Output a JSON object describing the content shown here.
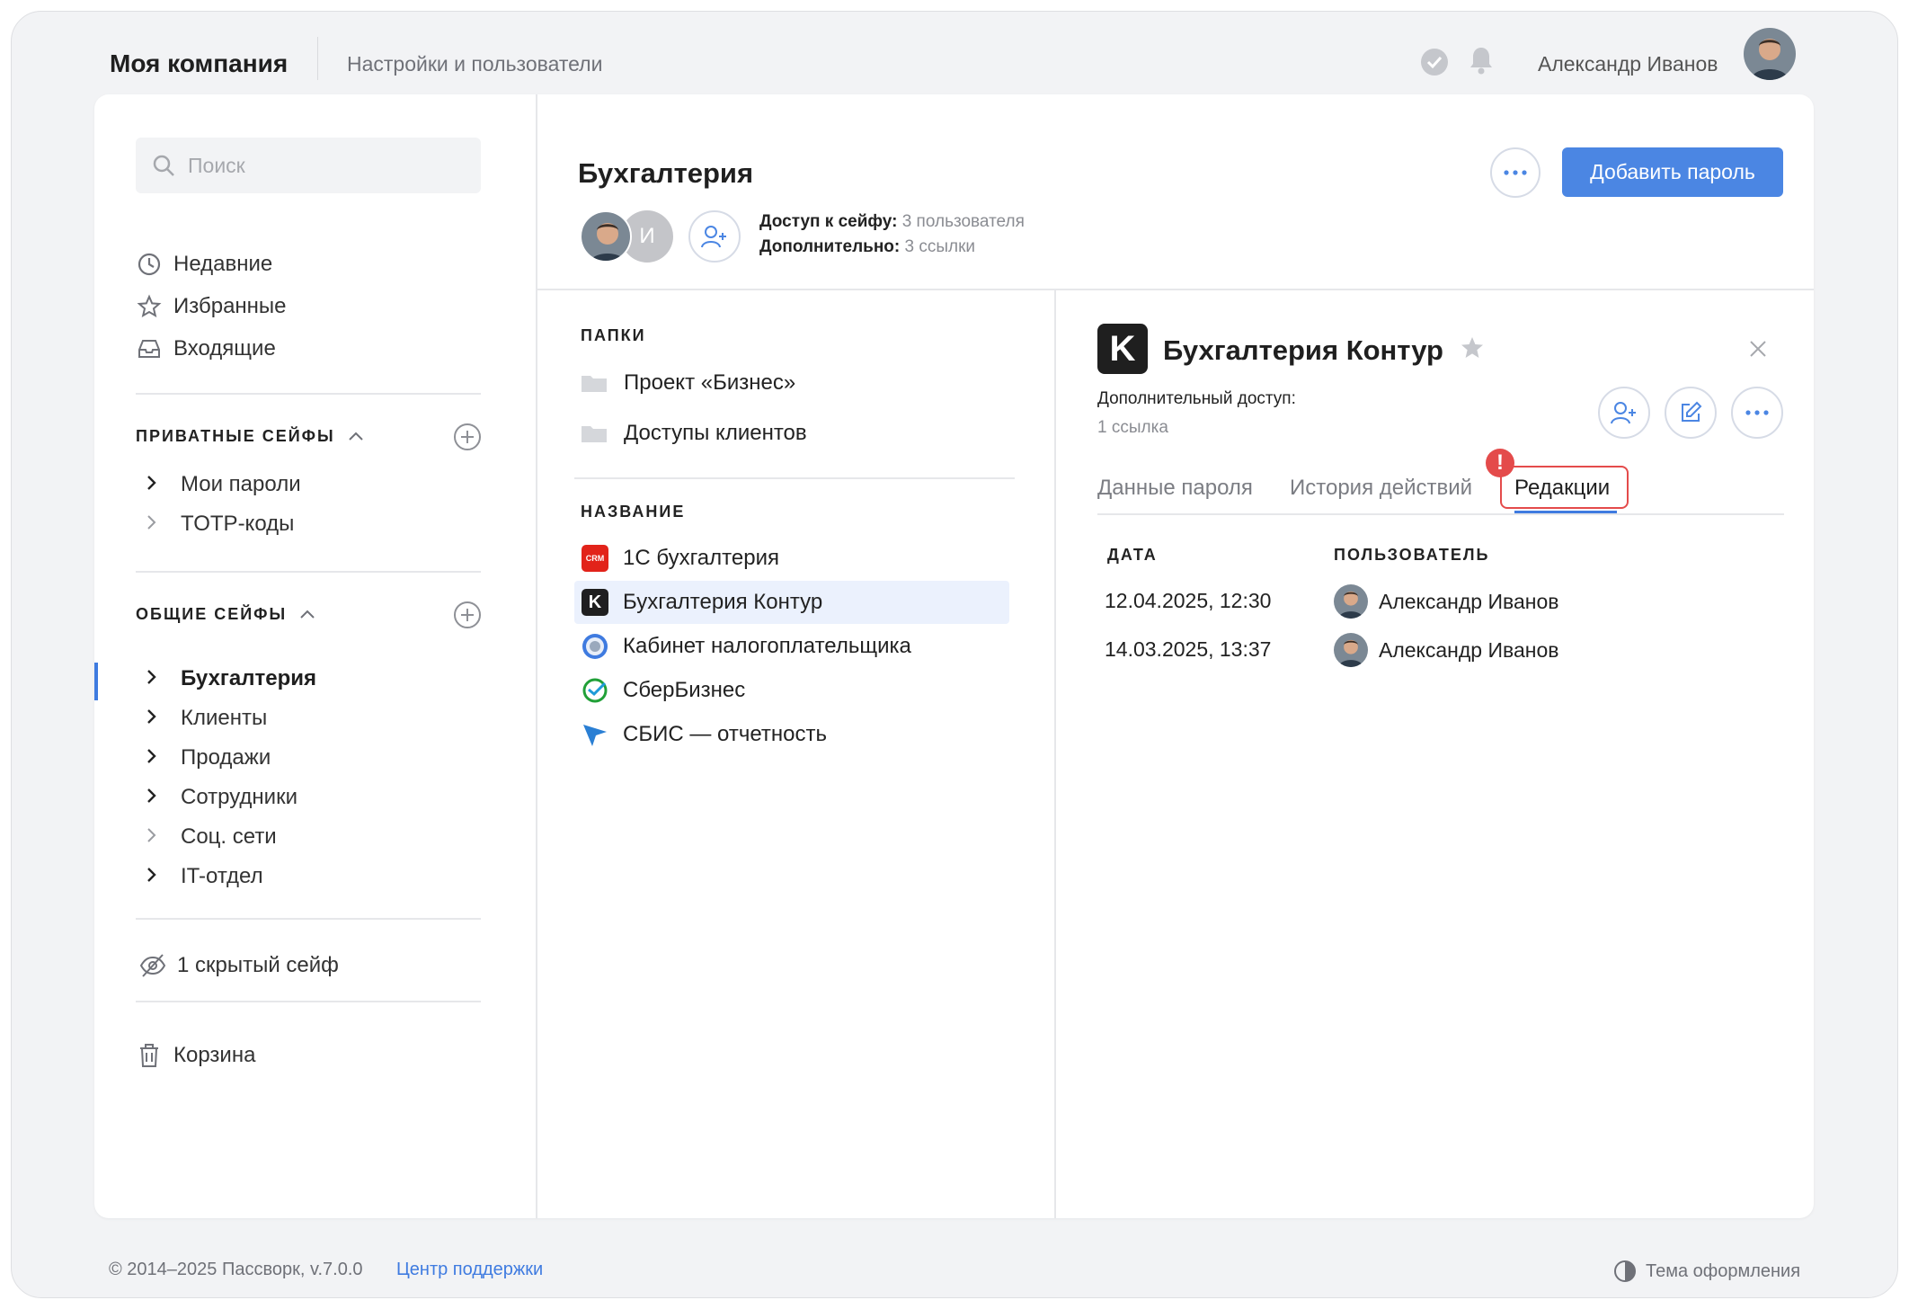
{
  "header": {
    "company": "Моя компания",
    "breadcrumb": "Настройки и пользователи",
    "user_name": "Александр Иванов"
  },
  "sidebar": {
    "search_placeholder": "Поиск",
    "nav": [
      {
        "label": "Недавние",
        "icon": "clock-icon"
      },
      {
        "label": "Избранные",
        "icon": "star-icon"
      },
      {
        "label": "Входящие",
        "icon": "inbox-icon"
      }
    ],
    "private_title": "ПРИВАТНЫЕ СЕЙФЫ",
    "private_vaults": [
      "Мои пароли",
      "TOTP-коды"
    ],
    "shared_title": "ОБЩИЕ СЕЙФЫ",
    "shared_vaults": [
      "Бухгалтерия",
      "Клиенты",
      "Продажи",
      "Сотрудники",
      "Соц. сети",
      "IT-отдел"
    ],
    "hidden": "1 скрытый сейф",
    "trash": "Корзина"
  },
  "vault": {
    "title": "Бухгалтерия",
    "avatar_initial": "И",
    "access_label": "Доступ к сейфу:",
    "access_value": "3 пользователя",
    "extra_label": "Дополнительно:",
    "extra_value": "3 ссылки",
    "add_button": "Добавить пароль"
  },
  "list": {
    "folders_title": "ПАПКИ",
    "folders": [
      "Проект «Бизнес»",
      "Доступы клиентов"
    ],
    "names_title": "НАЗВАНИЕ",
    "entries": [
      {
        "label": "1С бухгалтерия",
        "logo_text": "CRM"
      },
      {
        "label": "Бухгалтерия Контур",
        "logo_text": "K"
      },
      {
        "label": "Кабинет налогоплательщика"
      },
      {
        "label": "СберБизнес"
      },
      {
        "label": "СБИС — отчетность"
      }
    ]
  },
  "detail": {
    "logo_letter": "K",
    "title": "Бухгалтерия Контур",
    "extra_access_label": "Дополнительный доступ:",
    "extra_access_value": "1 ссылка",
    "tabs": [
      "Данные пароля",
      "История действий",
      "Редакции"
    ],
    "alert": "!",
    "columns": [
      "ДАТА",
      "ПОЛЬЗОВАТЕЛЬ"
    ],
    "rows": [
      {
        "date": "12.04.2025, 12:30",
        "user": "Александр Иванов"
      },
      {
        "date": "14.03.2025, 13:37",
        "user": "Александр Иванов"
      }
    ]
  },
  "footer": {
    "copyright": "© 2014–2025 Пассворк, v.7.0.0",
    "support": "Центр поддержки",
    "theme": "Тема оформления"
  },
  "colors": {
    "accent": "#4b86e3",
    "alert": "#e44b4b",
    "selected_bg": "#ebf1fd"
  }
}
